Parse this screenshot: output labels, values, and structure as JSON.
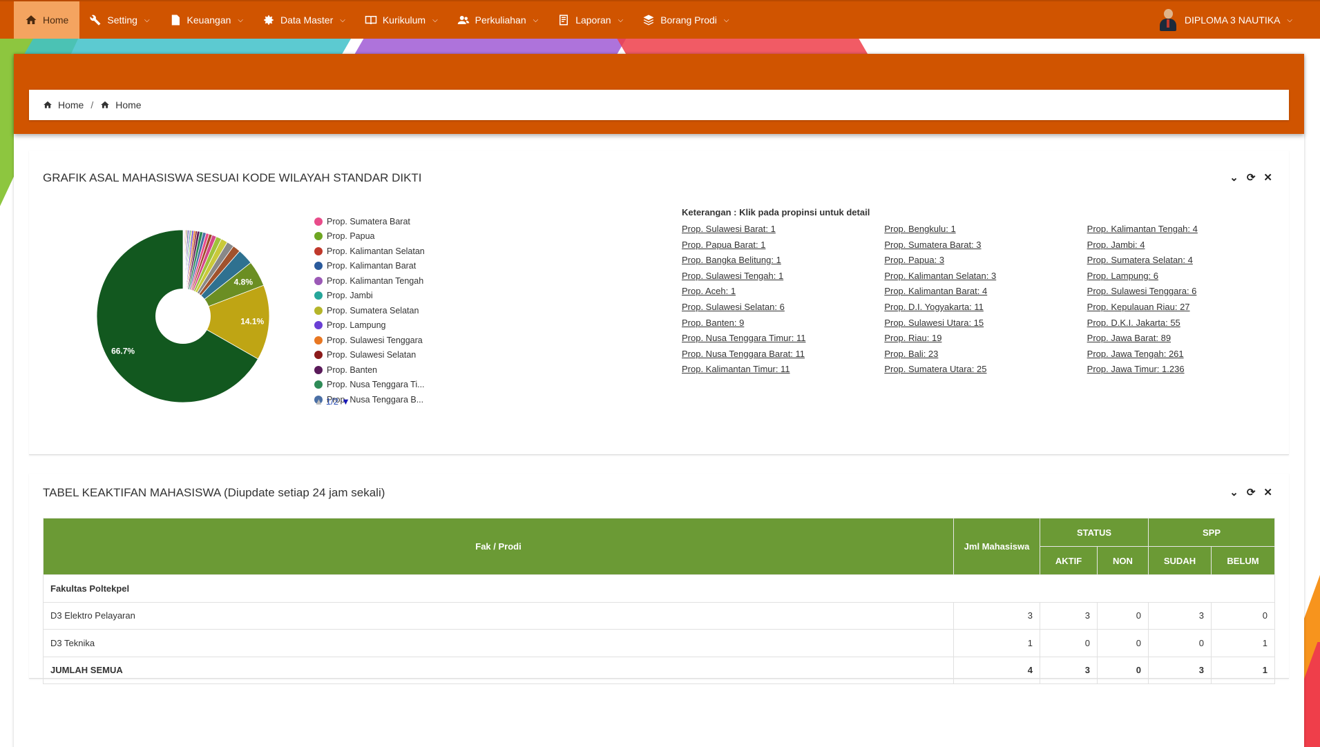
{
  "nav": {
    "items": [
      {
        "label": "Home",
        "icon": "home-icon"
      },
      {
        "label": "Setting",
        "icon": "wrench-icon"
      },
      {
        "label": "Keuangan",
        "icon": "document-icon"
      },
      {
        "label": "Data Master",
        "icon": "gear-icon"
      },
      {
        "label": "Kurikulum",
        "icon": "book-icon"
      },
      {
        "label": "Perkuliahan",
        "icon": "users-icon"
      },
      {
        "label": "Laporan",
        "icon": "report-icon"
      },
      {
        "label": "Borang Prodi",
        "icon": "layers-icon"
      }
    ],
    "user": "DIPLOMA 3 NAUTIKA"
  },
  "breadcrumb": {
    "first": "Home",
    "second": "Home"
  },
  "chart_card": {
    "title": "GRAFIK ASAL MAHASISWA SESUAI KODE WILAYAH STANDAR DIKTI",
    "pager": "1/2",
    "legend": [
      {
        "label": "Prop. Sumatera Barat",
        "color": "#e84c8a"
      },
      {
        "label": "Prop. Papua",
        "color": "#6ea622"
      },
      {
        "label": "Prop. Kalimantan Selatan",
        "color": "#c0392b"
      },
      {
        "label": "Prop. Kalimantan Barat",
        "color": "#2a5a9c"
      },
      {
        "label": "Prop. Kalimantan Tengah",
        "color": "#9b59b6"
      },
      {
        "label": "Prop. Jambi",
        "color": "#26a69a"
      },
      {
        "label": "Prop. Sumatera Selatan",
        "color": "#b5b52a"
      },
      {
        "label": "Prop. Lampung",
        "color": "#6a3fd5"
      },
      {
        "label": "Prop. Sulawesi Tenggara",
        "color": "#e87722"
      },
      {
        "label": "Prop. Sulawesi Selatan",
        "color": "#8b1a1a"
      },
      {
        "label": "Prop. Banten",
        "color": "#5a1a5a"
      },
      {
        "label": "Prop. Nusa Tenggara Ti...",
        "color": "#2e8b57"
      },
      {
        "label": "Prop. Nusa Tenggara B...",
        "color": "#4a6fa5"
      }
    ],
    "keterangan_title": "Keterangan : Klik pada propinsi untuk detail",
    "keterangan_cols": [
      [
        "Prop. Sulawesi Barat: 1",
        "Prop. Papua Barat: 1",
        "Prop. Bangka Belitung: 1",
        "Prop. Sulawesi Tengah: 1",
        "Prop. Aceh: 1",
        "Prop. Sulawesi Selatan: 6",
        "Prop. Banten: 9",
        "Prop. Nusa Tenggara Timur: 11",
        "Prop. Nusa Tenggara Barat: 11",
        "Prop. Kalimantan Timur: 11"
      ],
      [
        "Prop. Bengkulu: 1",
        "Prop. Sumatera Barat: 3",
        "Prop. Papua: 3",
        "Prop. Kalimantan Selatan: 3",
        "Prop. Kalimantan Barat: 4",
        "Prop. D.I. Yogyakarta: 11",
        "Prop. Sulawesi Utara: 15",
        "Prop. Riau: 19",
        "Prop. Bali: 23",
        "Prop. Sumatera Utara: 25"
      ],
      [
        "Prop. Kalimantan Tengah: 4",
        "Prop. Jambi: 4",
        "Prop. Sumatera Selatan: 4",
        "Prop. Lampung: 6",
        "Prop. Sulawesi Tenggara: 6",
        "Prop. Kepulauan Riau: 27",
        "Prop. D.K.I. Jakarta: 55",
        "Prop. Jawa Barat: 89",
        "Prop. Jawa Tengah: 261",
        "Prop. Jawa Timur: 1.236"
      ]
    ]
  },
  "chart_data": {
    "type": "pie",
    "donut": true,
    "title": "",
    "slices": [
      {
        "label": "Prop. Sulawesi Barat",
        "value": 1,
        "color": "#d0d0d0"
      },
      {
        "label": "Prop. Papua Barat",
        "value": 1,
        "color": "#c9a0dc"
      },
      {
        "label": "Prop. Bangka Belitung",
        "value": 1,
        "color": "#7fb3d5"
      },
      {
        "label": "Prop. Sulawesi Tengah",
        "value": 1,
        "color": "#f1948a"
      },
      {
        "label": "Prop. Aceh",
        "value": 1,
        "color": "#82e0aa"
      },
      {
        "label": "Prop. Bengkulu",
        "value": 1,
        "color": "#f8c471"
      },
      {
        "label": "Prop. Sumatera Barat",
        "value": 3,
        "color": "#e84c8a"
      },
      {
        "label": "Prop. Papua",
        "value": 3,
        "color": "#6ea622"
      },
      {
        "label": "Prop. Kalimantan Selatan",
        "value": 3,
        "color": "#c0392b"
      },
      {
        "label": "Prop. Kalimantan Barat",
        "value": 4,
        "color": "#2a5a9c"
      },
      {
        "label": "Prop. Kalimantan Tengah",
        "value": 4,
        "color": "#9b59b6"
      },
      {
        "label": "Prop. Jambi",
        "value": 4,
        "color": "#26a69a"
      },
      {
        "label": "Prop. Sumatera Selatan",
        "value": 4,
        "color": "#b5b52a"
      },
      {
        "label": "Prop. Lampung",
        "value": 6,
        "color": "#6a3fd5"
      },
      {
        "label": "Prop. Sulawesi Tenggara",
        "value": 6,
        "color": "#e87722"
      },
      {
        "label": "Prop. Sulawesi Selatan",
        "value": 6,
        "color": "#8b1a1a"
      },
      {
        "label": "Prop. Banten",
        "value": 9,
        "color": "#5a1a5a"
      },
      {
        "label": "Prop. Nusa Tenggara Timur",
        "value": 11,
        "color": "#2e8b57"
      },
      {
        "label": "Prop. Nusa Tenggara Barat",
        "value": 11,
        "color": "#4a6fa5"
      },
      {
        "label": "Prop. Kalimantan Timur",
        "value": 11,
        "color": "#e84c8a"
      },
      {
        "label": "Prop. D.I. Yogyakarta",
        "value": 11,
        "color": "#a04a2a"
      },
      {
        "label": "Prop. Sulawesi Utara",
        "value": 15,
        "color": "#d4488a"
      },
      {
        "label": "Prop. Riau",
        "value": 19,
        "color": "#9fc23a"
      },
      {
        "label": "Prop. Bali",
        "value": 23,
        "color": "#c9c93a"
      },
      {
        "label": "Prop. Sumatera Utara",
        "value": 25,
        "color": "#888888"
      },
      {
        "label": "Prop. Kepulauan Riau",
        "value": 27,
        "color": "#a0522d"
      },
      {
        "label": "Prop. D.K.I. Jakarta",
        "value": 55,
        "color": "#2f7190"
      },
      {
        "label": "Prop. Jawa Barat",
        "value": 89,
        "color": "#6b8e23"
      },
      {
        "label": "Prop. Jawa Tengah",
        "value": 261,
        "color": "#bfa514"
      },
      {
        "label": "Prop. Jawa Timur",
        "value": 1236,
        "color": "#12581f"
      }
    ],
    "labels": [
      {
        "text": "4.8%",
        "slice": "Prop. Jawa Barat"
      },
      {
        "text": "14.1%",
        "slice": "Prop. Jawa Tengah"
      },
      {
        "text": "66.7%",
        "slice": "Prop. Jawa Timur"
      }
    ]
  },
  "table_card": {
    "title": "TABEL KEAKTIFAN MAHASISWA (Diupdate setiap 24 jam sekali)",
    "headers": {
      "fak": "Fak / Prodi",
      "jml": "Jml Mahasiswa",
      "status": "STATUS",
      "aktif": "AKTIF",
      "non": "NON",
      "spp": "SPP",
      "sudah": "SUDAH",
      "belum": "BELUM"
    },
    "faculty": "Fakultas Poltekpel",
    "rows": [
      {
        "name": "D3 Elektro Pelayaran",
        "jml": "3",
        "aktif": "3",
        "non": "0",
        "sudah": "3",
        "belum": "0"
      },
      {
        "name": "D3 Teknika",
        "jml": "1",
        "aktif": "0",
        "non": "0",
        "sudah": "0",
        "belum": "1"
      }
    ],
    "total": {
      "name": "JUMLAH SEMUA",
      "jml": "4",
      "aktif": "3",
      "non": "0",
      "sudah": "3",
      "belum": "1"
    }
  }
}
